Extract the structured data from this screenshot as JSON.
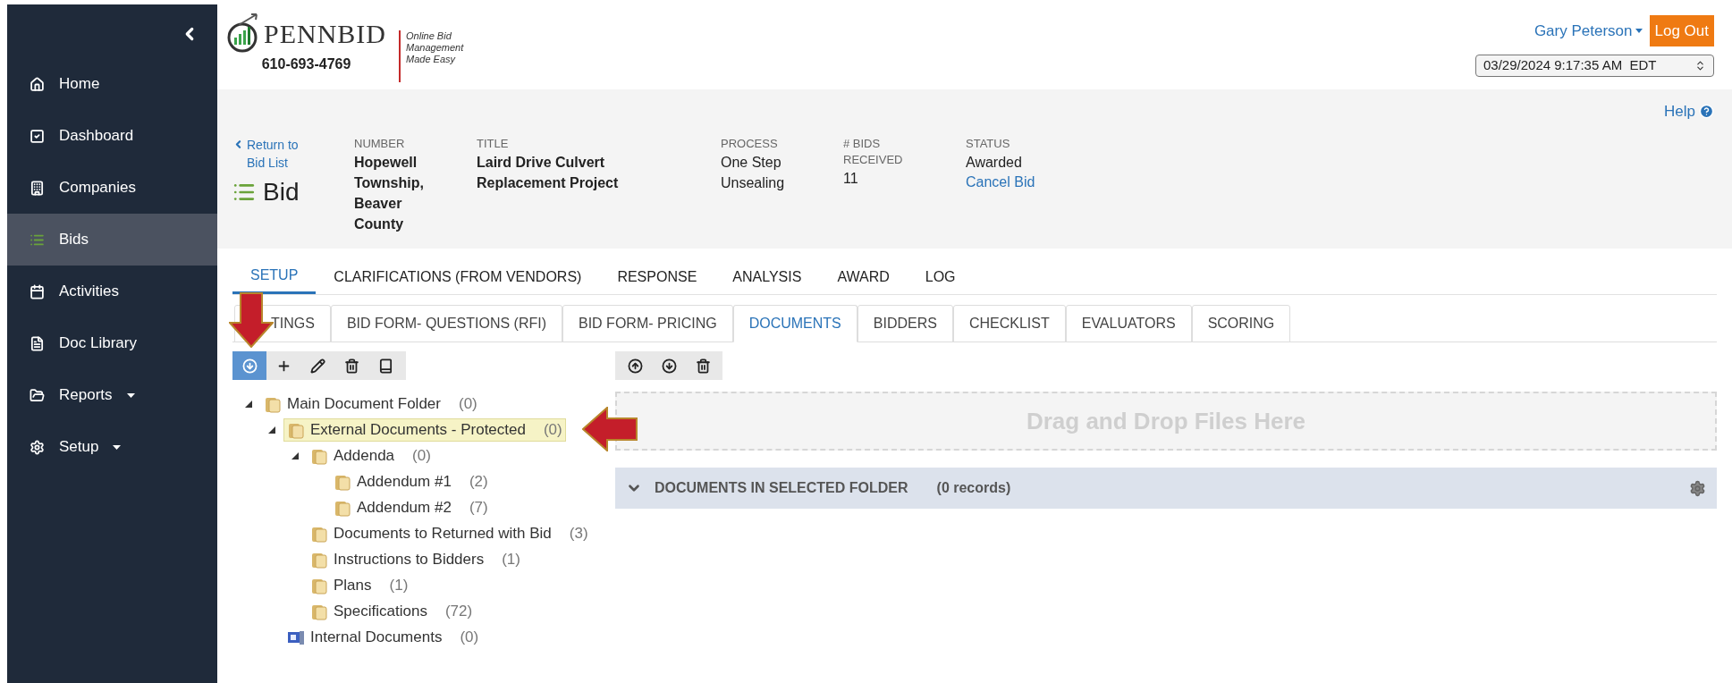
{
  "sidebar": {
    "items": [
      {
        "label": "Home",
        "selected": false,
        "dropdown": false
      },
      {
        "label": "Dashboard",
        "selected": false,
        "dropdown": false
      },
      {
        "label": "Companies",
        "selected": false,
        "dropdown": false
      },
      {
        "label": "Bids",
        "selected": true,
        "dropdown": false
      },
      {
        "label": "Activities",
        "selected": false,
        "dropdown": false
      },
      {
        "label": "Doc Library",
        "selected": false,
        "dropdown": false
      },
      {
        "label": "Reports",
        "selected": false,
        "dropdown": true
      },
      {
        "label": "Setup",
        "selected": false,
        "dropdown": true
      }
    ]
  },
  "header": {
    "logo": "PENNBID",
    "phone": "610-693-4769",
    "tagline": "Online Bid Management Made Easy",
    "user": "Gary Peterson",
    "logout": "Log Out",
    "datetime": "03/29/2024 9:17:35 AM  EDT"
  },
  "bid": {
    "back_link": "Return to Bid List",
    "heading": "Bid",
    "help": "Help",
    "fields": [
      {
        "label": "NUMBER",
        "value": "Hopewell Township, Beaver County",
        "kind": "bold"
      },
      {
        "label": "TITLE",
        "value": "Laird Drive Culvert Replacement Project",
        "kind": "bold"
      },
      {
        "label": "PROCESS",
        "value": "One Step Unsealing",
        "kind": "plain"
      },
      {
        "label": "# BIDS RECEIVED",
        "value": "11",
        "kind": "plain"
      },
      {
        "label": "STATUS",
        "value": "Awarded",
        "kind": "plain",
        "link": "Cancel Bid"
      }
    ]
  },
  "main_tabs": [
    {
      "label": "SETUP",
      "selected": true
    },
    {
      "label": "CLARIFICATIONS (FROM VENDORS)",
      "selected": false
    },
    {
      "label": "RESPONSE",
      "selected": false
    },
    {
      "label": "ANALYSIS",
      "selected": false
    },
    {
      "label": "AWARD",
      "selected": false
    },
    {
      "label": "LOG",
      "selected": false
    }
  ],
  "sub_tabs": [
    {
      "label": "TINGS",
      "selected": false
    },
    {
      "label": "BID FORM- QUESTIONS (RFI)",
      "selected": false
    },
    {
      "label": "BID FORM- PRICING",
      "selected": false
    },
    {
      "label": "DOCUMENTS",
      "selected": true
    },
    {
      "label": "BIDDERS",
      "selected": false
    },
    {
      "label": "CHECKLIST",
      "selected": false
    },
    {
      "label": "EVALUATORS",
      "selected": false
    },
    {
      "label": "SCORING",
      "selected": false
    }
  ],
  "folder_toolbar": [
    {
      "selected": true
    },
    {
      "selected": false
    },
    {
      "selected": false
    },
    {
      "selected": false
    },
    {
      "selected": false
    }
  ],
  "tree": [
    {
      "label": "Main Document Folder",
      "count": "(0)",
      "kind": "folder",
      "expanded": true,
      "selected": false,
      "children": [
        {
          "label": "External Documents - Protected",
          "count": "(0)",
          "kind": "folder",
          "expanded": true,
          "selected": true,
          "children": [
            {
              "label": "Addenda",
              "count": "(0)",
              "kind": "folder",
              "expanded": true,
              "selected": false,
              "children": [
                {
                  "label": "Addendum #1",
                  "count": "(2)",
                  "kind": "folder",
                  "selected": false
                },
                {
                  "label": "Addendum #2",
                  "count": "(7)",
                  "kind": "folder",
                  "selected": false
                }
              ]
            },
            {
              "label": "Documents to Returned with Bid",
              "count": "(3)",
              "kind": "folder",
              "selected": false
            },
            {
              "label": "Instructions to Bidders",
              "count": "(1)",
              "kind": "folder",
              "selected": false
            },
            {
              "label": "Plans",
              "count": "(1)",
              "kind": "folder",
              "selected": false
            },
            {
              "label": "Specifications",
              "count": "(72)",
              "kind": "folder",
              "selected": false
            }
          ]
        },
        {
          "label": "Internal Documents",
          "count": "(0)",
          "kind": "internal",
          "selected": false
        }
      ]
    }
  ],
  "drop_zone": "Drag and Drop Files Here",
  "documents_panel": {
    "title": "DOCUMENTS IN SELECTED FOLDER",
    "count": "(0 records)",
    "expanded": true
  }
}
